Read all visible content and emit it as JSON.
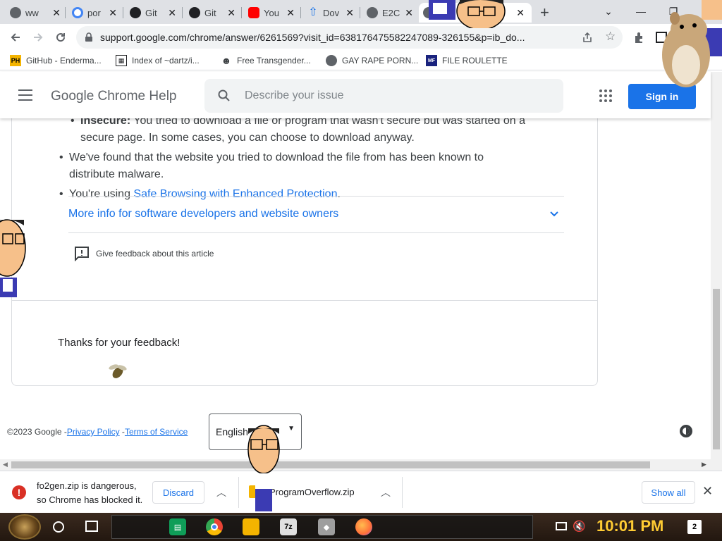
{
  "tabs": [
    {
      "title": "ww",
      "favicon_color": "#5f6368"
    },
    {
      "title": "por",
      "favicon_color": "#4285f4"
    },
    {
      "title": "Git",
      "favicon_color": "#202124"
    },
    {
      "title": "Git",
      "favicon_color": "#202124"
    },
    {
      "title": "You",
      "favicon_color": "#ff0000"
    },
    {
      "title": "Dov",
      "favicon_color": "#1a73e8"
    },
    {
      "title": "E2C",
      "favicon_color": "#5f6368"
    },
    {
      "title": "",
      "favicon_color": "#5f6368",
      "active": true
    }
  ],
  "new_tab_label": "+",
  "window_controls": {
    "minimize": "—",
    "maximize": "❐",
    "tablist": "⌄"
  },
  "toolbar": {
    "url": "support.google.com/chrome/answer/6261569?visit_id=638176475582247089-326",
    "url_tail": "155&p=ib_do..."
  },
  "bookmarks": [
    {
      "label": "GitHub - Enderma...",
      "icon": "PH",
      "icon_color": "#f4b400"
    },
    {
      "label": "Index of ~dartz/i...",
      "icon": "▦",
      "icon_color": "#202124"
    },
    {
      "label": "Free Transgender...",
      "icon": "☻",
      "icon_color": "#3c4043"
    },
    {
      "label": "GAY RAPE PORN...",
      "icon": "globe-icon",
      "icon_color": "#3c4043"
    },
    {
      "label": "FILE ROULETTE",
      "icon": "MF",
      "icon_color": "#1a237e"
    }
  ],
  "header": {
    "title": "Google Chrome Help",
    "search_placeholder": "Describe your issue",
    "signin_label": "Sign in"
  },
  "article": {
    "insecure_label": "Insecure:",
    "insecure_text": " You tried to download a file or program that wasn't secure but was started on a",
    "insecure_text2": "secure page. In some cases, you can choose to download anyway.",
    "malware_text": "We've found that the website you tried to download the file from has been known to",
    "malware_text2": "distribute malware.",
    "safebrowsing_prefix": "You're using ",
    "safebrowsing_link": "Safe Browsing with Enhanced Protection",
    "safebrowsing_suffix": ".",
    "more_info": "More info for software developers and website owners",
    "feedback": "Give feedback about this article",
    "thanks": "Thanks for your feedback!"
  },
  "footer": {
    "copyright": "©2023 Google -",
    "privacy": "Privacy Policy",
    "dash": " -",
    "terms": "Terms of Service",
    "language": "English"
  },
  "downloads": {
    "item1_line1": "fo2gen.zip is dangerous,",
    "item1_line2": "so Chrome has blocked it.",
    "discard_label": "Discard",
    "item2_name": "ProgramOverflow.zip",
    "show_all_label": "Show all"
  },
  "taskbar": {
    "clock": "10:01 PM",
    "notifications": "2",
    "pinned": [
      {
        "name": "sheets-app",
        "label": "▤",
        "color": "#0f9d58"
      },
      {
        "name": "chrome-app",
        "label": "",
        "color": "#ea4335"
      },
      {
        "name": "file-explorer-app",
        "label": "",
        "color": "#f4b400"
      },
      {
        "name": "7zip-app",
        "label": "7z",
        "color": "#e0e0e0"
      },
      {
        "name": "paint-app",
        "label": "◆",
        "color": "#9e9e9e"
      },
      {
        "name": "firefox-app",
        "label": "",
        "color": "#ff7139"
      }
    ]
  }
}
